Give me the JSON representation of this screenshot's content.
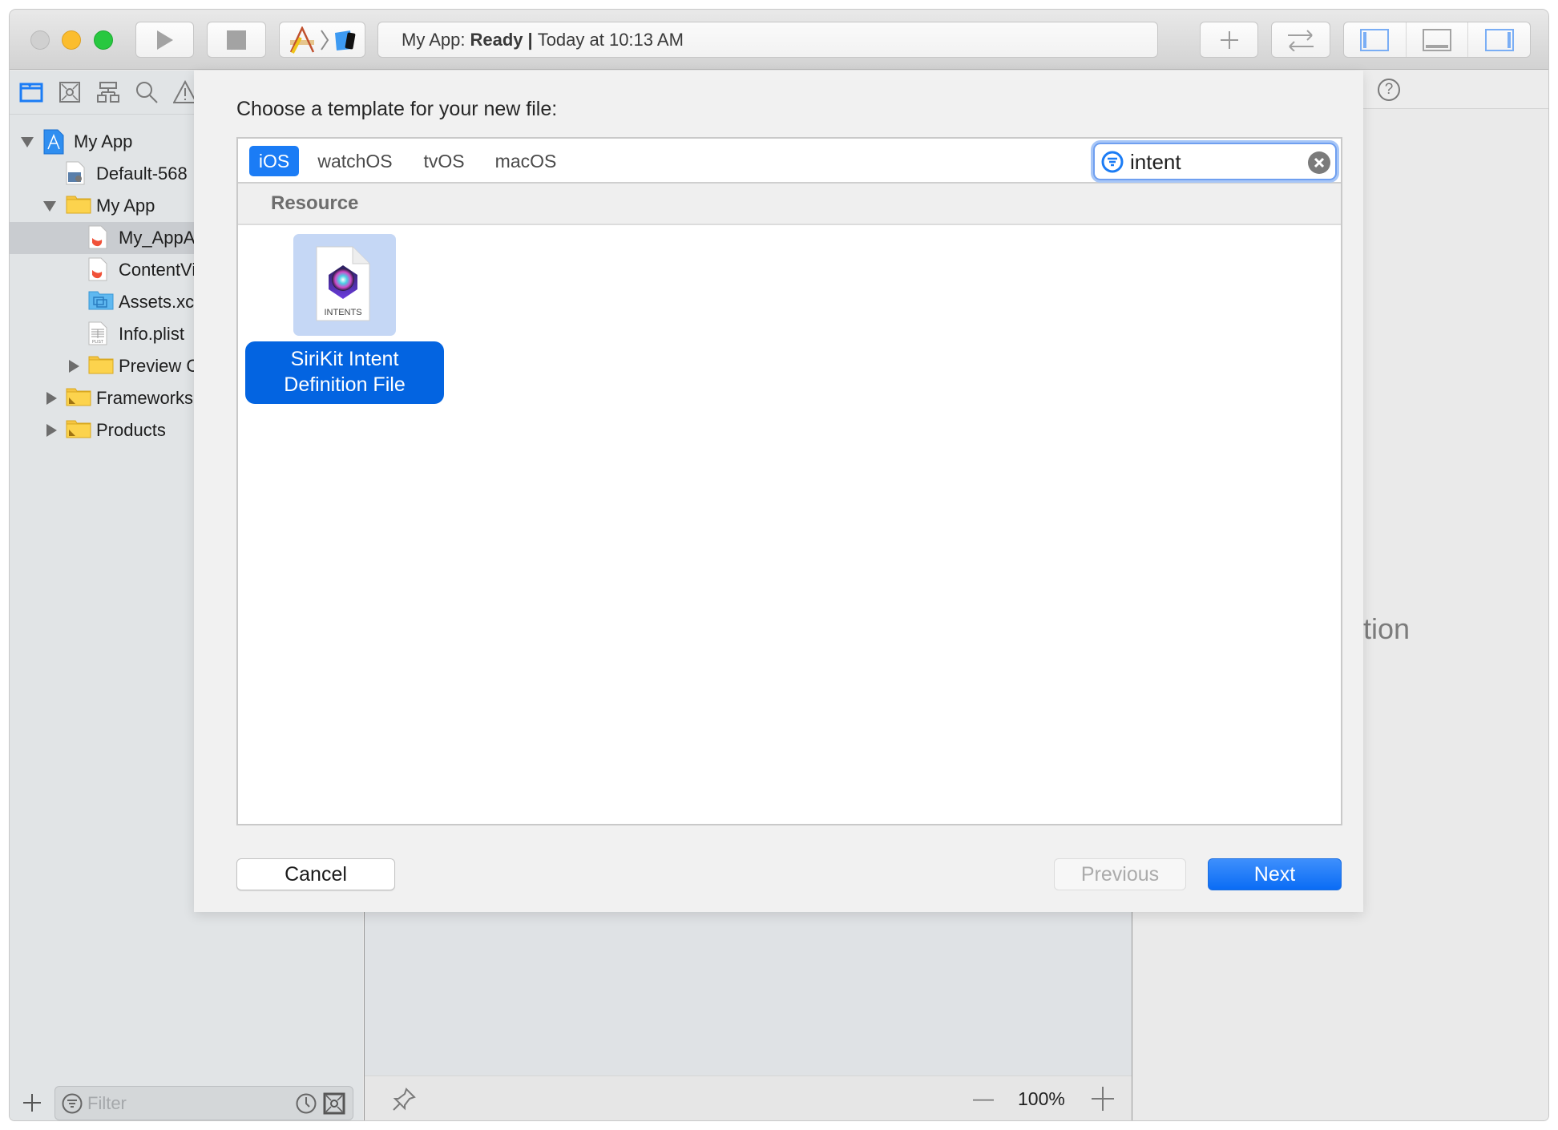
{
  "toolbar": {
    "traffic_lights": [
      "close",
      "minimize",
      "zoom"
    ],
    "run_icon": "play-icon",
    "stop_icon": "stop-icon",
    "scheme": {
      "app_icon": "xcode-app-icon",
      "separator": "chevron-right-icon",
      "device_icon": "ios-device-icon"
    },
    "status": {
      "project": "My App:",
      "state": "Ready",
      "separator": "|",
      "time": "Today at 10:13 AM"
    },
    "buttons": [
      "add-library-icon",
      "code-review-icon",
      "show-navigator-icon",
      "show-debug-area-icon",
      "show-inspector-icon"
    ]
  },
  "navigator": {
    "tabs": [
      "project-navigator",
      "source-control-navigator",
      "symbol-navigator",
      "find-navigator",
      "issue-navigator"
    ],
    "tree": [
      {
        "label": "My App",
        "level": 0,
        "disclosure": "open",
        "icon": "xcodeproj-icon"
      },
      {
        "label": "Default-568",
        "level": 1,
        "disclosure": "none",
        "icon": "image-file-icon"
      },
      {
        "label": "My App",
        "level": 1,
        "disclosure": "open",
        "icon": "folder-icon"
      },
      {
        "label": "My_AppAp",
        "level": 2,
        "disclosure": "none",
        "icon": "swift-file-icon",
        "selected": true
      },
      {
        "label": "ContentVi",
        "level": 2,
        "disclosure": "none",
        "icon": "swift-file-icon"
      },
      {
        "label": "Assets.xc",
        "level": 2,
        "disclosure": "none",
        "icon": "asset-catalog-icon"
      },
      {
        "label": "Info.plist",
        "level": 2,
        "disclosure": "none",
        "icon": "plist-file-icon"
      },
      {
        "label": "Preview C",
        "level": 2,
        "disclosure": "closed",
        "icon": "folder-icon"
      },
      {
        "label": "Frameworks",
        "level": 1,
        "disclosure": "closed",
        "icon": "group-folder-icon"
      },
      {
        "label": "Products",
        "level": 1,
        "disclosure": "closed",
        "icon": "group-folder-icon"
      }
    ],
    "filter_placeholder": "Filter",
    "add_label": "+"
  },
  "editor": {
    "zoom_level": "100%",
    "zoom_out": "—",
    "zoom_in": "+"
  },
  "inspector": {
    "help_icon": "?",
    "partial_text": "ction"
  },
  "dialog": {
    "title": "Choose a template for your new file:",
    "platforms": [
      {
        "label": "iOS",
        "active": true
      },
      {
        "label": "watchOS",
        "active": false
      },
      {
        "label": "tvOS",
        "active": false
      },
      {
        "label": "macOS",
        "active": false
      }
    ],
    "search_value": "intent",
    "section": "Resource",
    "templates": [
      {
        "icon_caption": "INTENTS",
        "label_line1": "SiriKit Intent",
        "label_line2": "Definition File",
        "selected": true
      }
    ],
    "cancel_label": "Cancel",
    "previous_label": "Previous",
    "next_label": "Next",
    "previous_enabled": false
  },
  "colors": {
    "accent": "#1b7cf5",
    "selection_label": "#0364e1",
    "selection_tile": "#c5d7f5",
    "traffic_close": "#d0d0d0",
    "traffic_minimize": "#fbbd2e",
    "traffic_zoom": "#28c840"
  }
}
